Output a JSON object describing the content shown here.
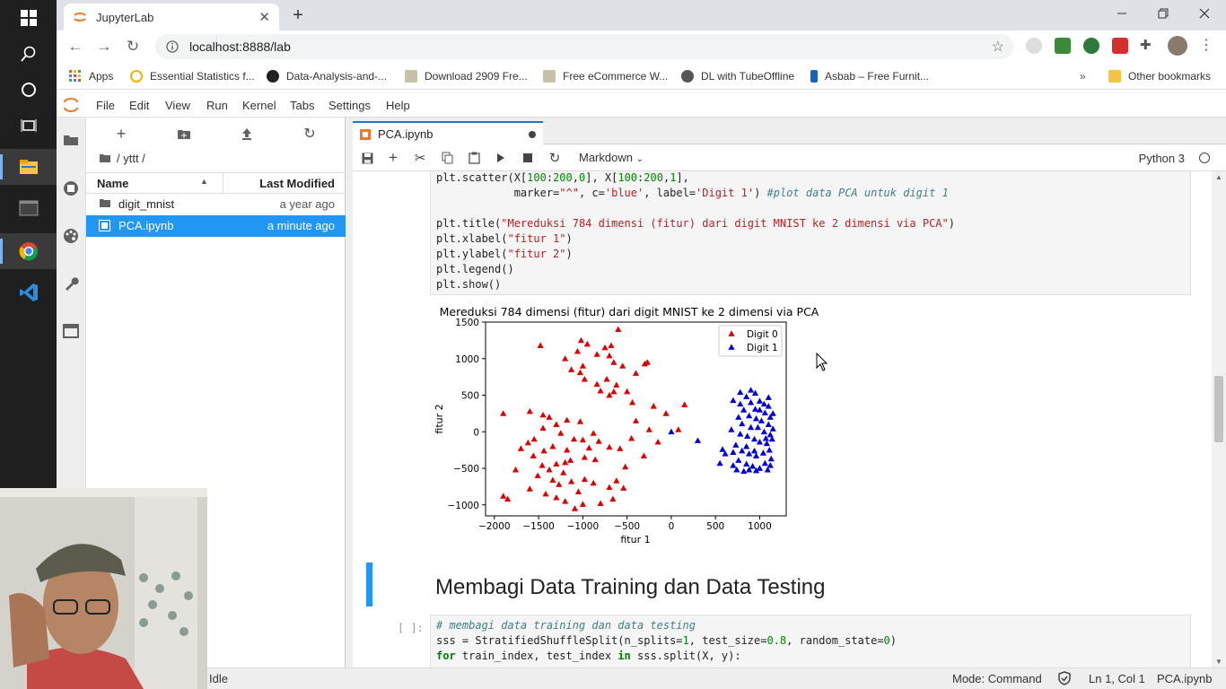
{
  "browser": {
    "tab_title": "JupyterLab",
    "url": "localhost:8888/lab",
    "bookmarks": [
      "Apps",
      "Essential Statistics f...",
      "Data-Analysis-and-...",
      "Download 2909 Fre...",
      "Free eCommerce W...",
      "DL with TubeOffline",
      "Asbab – Free Furnit..."
    ],
    "other_bookmarks": "Other bookmarks"
  },
  "menu": [
    "File",
    "Edit",
    "View",
    "Run",
    "Kernel",
    "Tabs",
    "Settings",
    "Help"
  ],
  "filebrowser": {
    "path": "/ yttt /",
    "col_name": "Name",
    "col_modified": "Last Modified",
    "files": [
      {
        "name": "digit_mnist",
        "modified": "a year ago",
        "type": "folder"
      },
      {
        "name": "PCA.ipynb",
        "modified": "a minute ago",
        "type": "notebook"
      }
    ]
  },
  "notebook": {
    "tab_title": "PCA.ipynb",
    "cell_type": "Markdown",
    "kernel": "Python 3",
    "heading": "Membagi Data Training dan Data Testing",
    "prompt": "[ ]:"
  },
  "status": {
    "state": "Idle",
    "mode": "Mode: Command",
    "position": "Ln 1, Col 1",
    "file": "PCA.ipynb"
  },
  "chart_data": {
    "type": "scatter",
    "title": "Mereduksi 784 dimensi (fitur) dari digit MNIST ke 2 dimensi via PCA",
    "xlabel": "fitur 1",
    "ylabel": "fitur 2",
    "xlim": [
      -2100,
      1300
    ],
    "ylim": [
      -1150,
      1500
    ],
    "xticks": [
      -2000,
      -1500,
      -1000,
      -500,
      0,
      500,
      1000
    ],
    "yticks": [
      -1000,
      -500,
      0,
      500,
      1000,
      1500
    ],
    "legend": "top-right",
    "series": [
      {
        "name": "Digit 0",
        "color": "#dd0000",
        "marker": "^",
        "points": [
          [
            -1480,
            1180
          ],
          [
            -1020,
            1250
          ],
          [
            -950,
            1200
          ],
          [
            -1060,
            1100
          ],
          [
            -750,
            1150
          ],
          [
            -680,
            1180
          ],
          [
            -600,
            1400
          ],
          [
            -1200,
            1000
          ],
          [
            -1130,
            850
          ],
          [
            -1000,
            900
          ],
          [
            -840,
            1060
          ],
          [
            -700,
            1040
          ],
          [
            -650,
            950
          ],
          [
            -550,
            900
          ],
          [
            -270,
            950
          ],
          [
            -300,
            930
          ],
          [
            -400,
            800
          ],
          [
            -1030,
            810
          ],
          [
            -980,
            720
          ],
          [
            -840,
            650
          ],
          [
            -730,
            720
          ],
          [
            -620,
            640
          ],
          [
            -800,
            560
          ],
          [
            -700,
            500
          ],
          [
            -650,
            550
          ],
          [
            -500,
            550
          ],
          [
            -440,
            400
          ],
          [
            -200,
            350
          ],
          [
            150,
            370
          ],
          [
            -1900,
            250
          ],
          [
            -1600,
            280
          ],
          [
            -1450,
            230
          ],
          [
            -1380,
            200
          ],
          [
            -1450,
            50
          ],
          [
            -1300,
            100
          ],
          [
            -1250,
            -20
          ],
          [
            -1180,
            160
          ],
          [
            -1030,
            140
          ],
          [
            -880,
            -20
          ],
          [
            -1000,
            -110
          ],
          [
            -930,
            -220
          ],
          [
            -1100,
            -100
          ],
          [
            -1550,
            -100
          ],
          [
            -1700,
            -230
          ],
          [
            -1620,
            -150
          ],
          [
            -1340,
            -200
          ],
          [
            -1180,
            -250
          ],
          [
            -1140,
            -390
          ],
          [
            -1220,
            -560
          ],
          [
            -980,
            -350
          ],
          [
            -860,
            -380
          ],
          [
            -820,
            -130
          ],
          [
            -700,
            -210
          ],
          [
            -580,
            -230
          ],
          [
            -1460,
            -460
          ],
          [
            -1380,
            -520
          ],
          [
            -1300,
            -440
          ],
          [
            -1200,
            -420
          ],
          [
            -1510,
            -600
          ],
          [
            -1340,
            -660
          ],
          [
            -1270,
            -720
          ],
          [
            -1130,
            -680
          ],
          [
            -1600,
            -780
          ],
          [
            -1420,
            -850
          ],
          [
            -1300,
            -900
          ],
          [
            -1200,
            -950
          ],
          [
            -1050,
            -820
          ],
          [
            -980,
            -650
          ],
          [
            -880,
            -700
          ],
          [
            -700,
            -760
          ],
          [
            -620,
            -670
          ],
          [
            -540,
            -770
          ],
          [
            -660,
            -920
          ],
          [
            -800,
            -980
          ],
          [
            -1850,
            -920
          ],
          [
            -1760,
            -520
          ],
          [
            -1900,
            -880
          ],
          [
            -1000,
            -990
          ],
          [
            -450,
            -90
          ],
          [
            -310,
            -330
          ],
          [
            -400,
            150
          ],
          [
            -250,
            30
          ],
          [
            -150,
            -140
          ],
          [
            -60,
            250
          ],
          [
            -520,
            -480
          ],
          [
            -1090,
            -1050
          ],
          [
            80,
            30
          ],
          [
            -1440,
            -260
          ],
          [
            -1560,
            -330
          ]
        ]
      },
      {
        "name": "Digit 1",
        "color": "#0000dd",
        "marker": "^",
        "points": [
          [
            900,
            570
          ],
          [
            950,
            530
          ],
          [
            780,
            540
          ],
          [
            850,
            480
          ],
          [
            700,
            430
          ],
          [
            780,
            380
          ],
          [
            900,
            400
          ],
          [
            1000,
            420
          ],
          [
            1050,
            380
          ],
          [
            1100,
            350
          ],
          [
            820,
            300
          ],
          [
            950,
            310
          ],
          [
            1000,
            300
          ],
          [
            1060,
            260
          ],
          [
            1120,
            200
          ],
          [
            760,
            200
          ],
          [
            880,
            220
          ],
          [
            960,
            180
          ],
          [
            1020,
            150
          ],
          [
            1100,
            100
          ],
          [
            1150,
            40
          ],
          [
            800,
            110
          ],
          [
            900,
            60
          ],
          [
            980,
            60
          ],
          [
            1050,
            0
          ],
          [
            1120,
            -40
          ],
          [
            680,
            30
          ],
          [
            780,
            -30
          ],
          [
            860,
            -60
          ],
          [
            940,
            -100
          ],
          [
            1000,
            -140
          ],
          [
            1080,
            -160
          ],
          [
            1140,
            -100
          ],
          [
            580,
            -240
          ],
          [
            700,
            -280
          ],
          [
            800,
            -260
          ],
          [
            880,
            -300
          ],
          [
            960,
            -330
          ],
          [
            1040,
            -290
          ],
          [
            1110,
            -250
          ],
          [
            760,
            -390
          ],
          [
            850,
            -440
          ],
          [
            920,
            -470
          ],
          [
            1000,
            -500
          ],
          [
            1060,
            -430
          ],
          [
            740,
            -520
          ],
          [
            820,
            -540
          ],
          [
            880,
            -520
          ],
          [
            960,
            -530
          ],
          [
            700,
            -460
          ],
          [
            550,
            -430
          ],
          [
            610,
            -300
          ],
          [
            730,
            -180
          ],
          [
            1090,
            -520
          ],
          [
            1130,
            -370
          ],
          [
            1150,
            250
          ],
          [
            1100,
            470
          ],
          [
            850,
            -200
          ],
          [
            940,
            -260
          ],
          [
            1070,
            -90
          ],
          [
            1120,
            -460
          ],
          [
            0,
            0
          ],
          [
            300,
            -120
          ]
        ]
      }
    ]
  }
}
